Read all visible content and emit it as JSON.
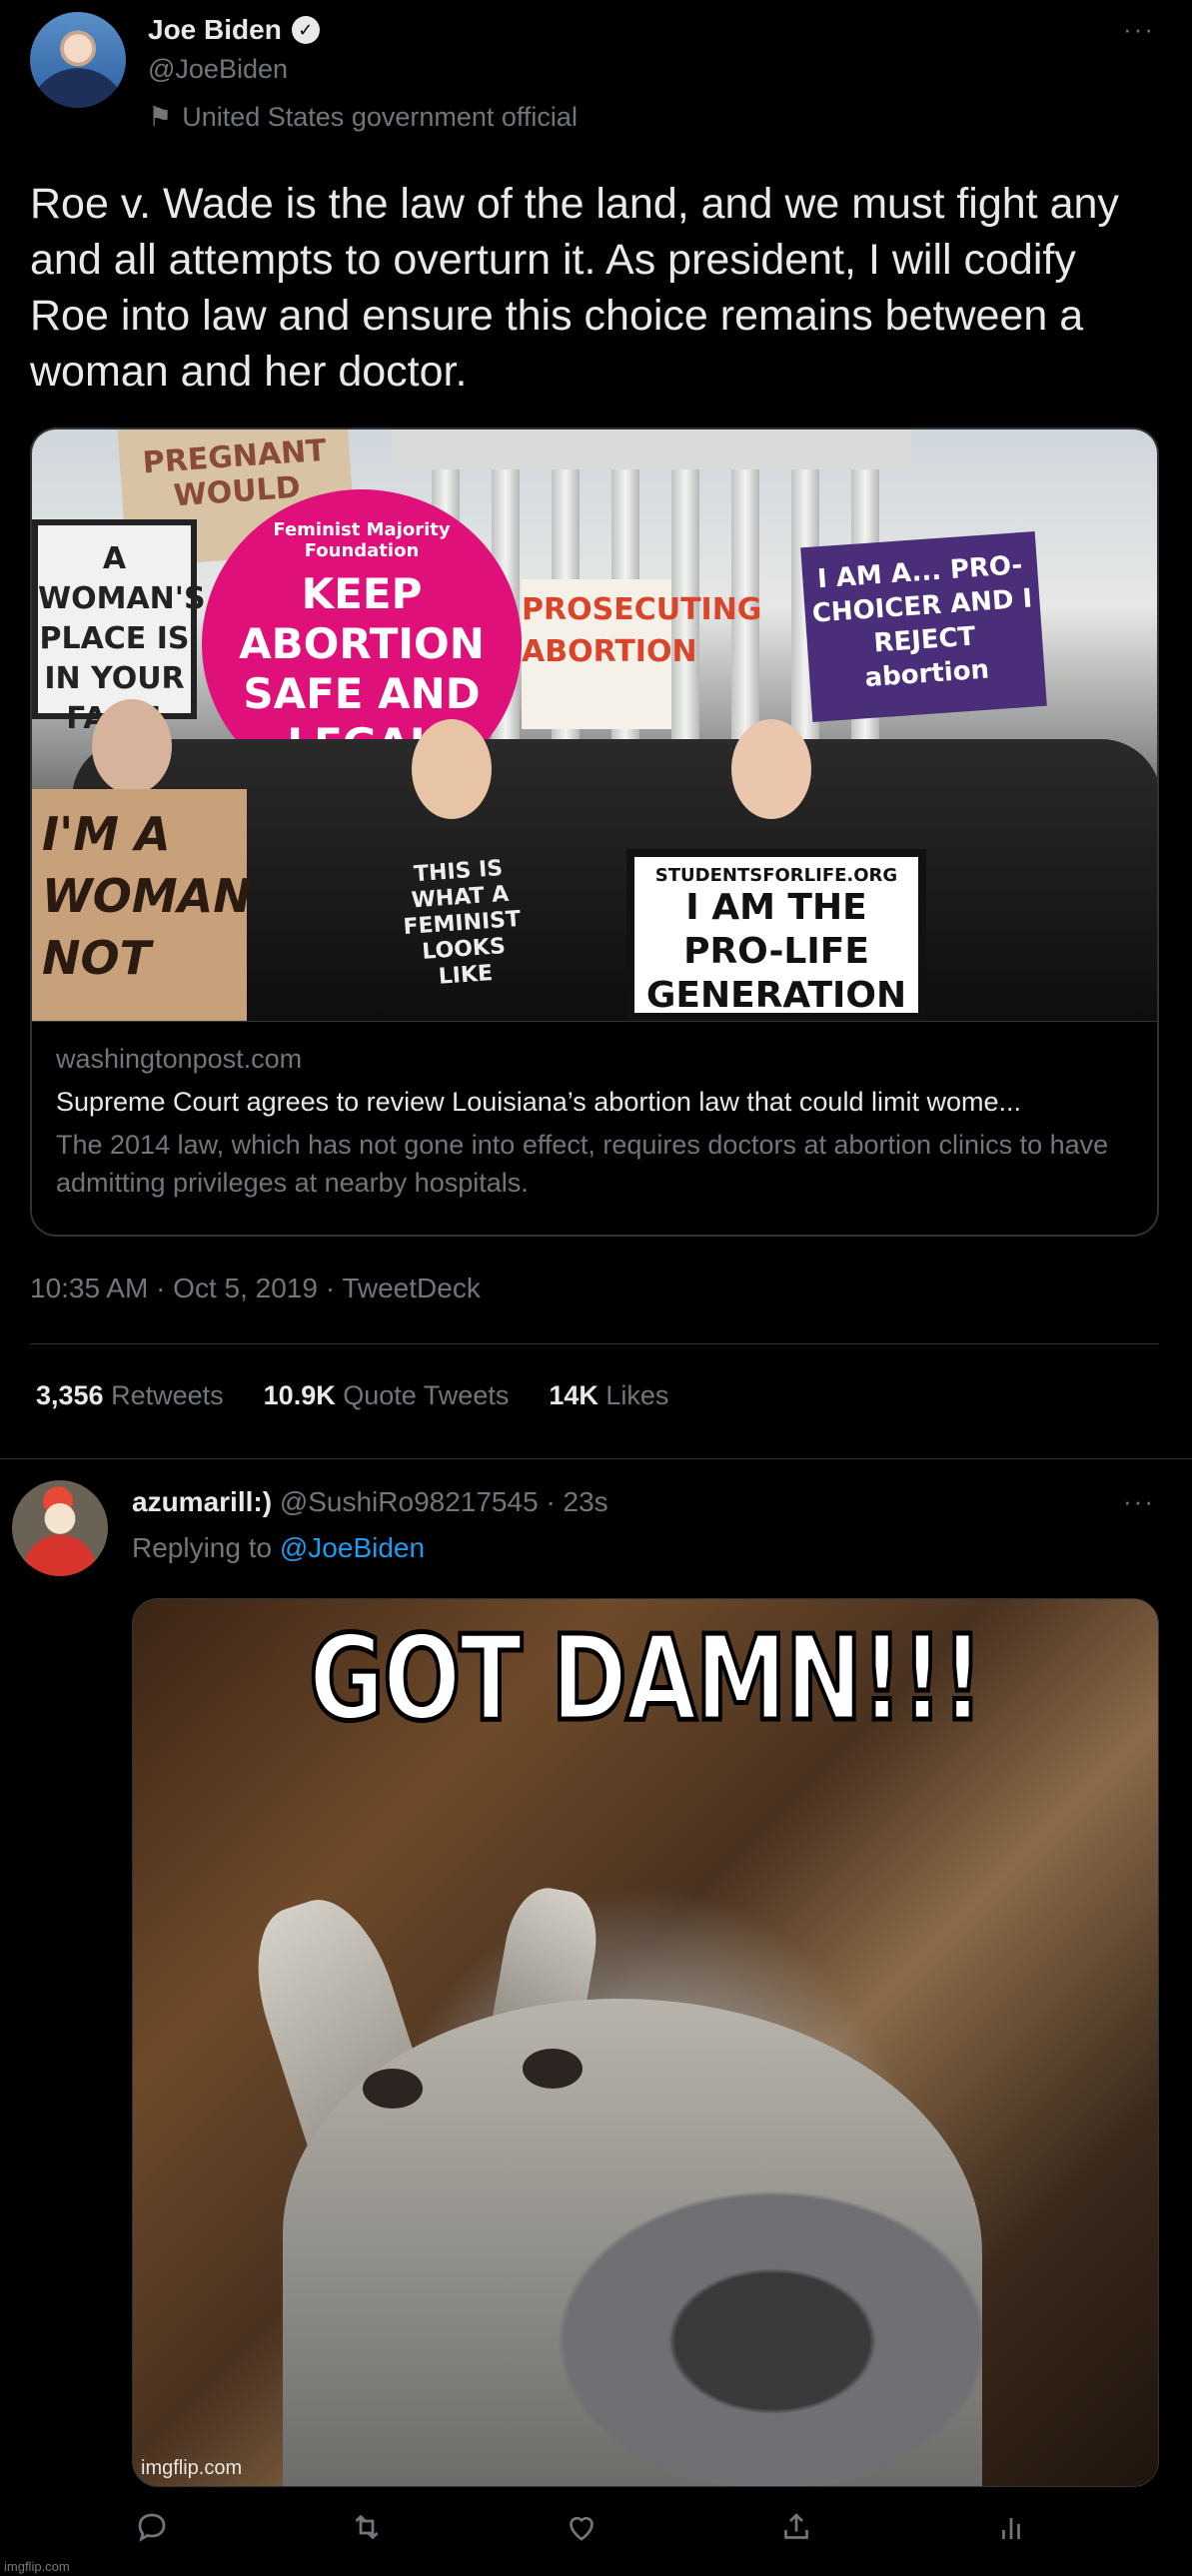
{
  "tweet": {
    "author_name": "Joe Biden",
    "author_handle": "@JoeBiden",
    "label": "United States government official",
    "more": "···",
    "text": "Roe v. Wade is the law of the land, and we must fight any and all attempts to overturn it. As president, I will codify Roe into law and ensure this choice remains between a woman and her doctor.",
    "card": {
      "image_signs": {
        "sign1": "KEEP ABORTION SAFE AND LEGAL",
        "sign1_org": "Feminist Majority Foundation",
        "sign2": "I AM THE PRO-LIFE GENERATION",
        "sign2_org": "STUDENTSFORLIFE.ORG",
        "sign3": "I AM A... PRO-CHOICER AND I REJECT abortion",
        "sign4": "I'M A WOMAN NOT",
        "sign5": "A WOMAN'S PLACE IS IN YOUR FACE!",
        "sign6": "PROSECUTING ABORTION",
        "sign7": "PREGNANT WOULD",
        "shirt": "THIS IS WHAT A FEMINIST LOOKS LIKE"
      },
      "domain": "washingtonpost.com",
      "title": "Supreme Court agrees to review Louisiana’s abortion law that could limit wome...",
      "description": "The 2014 law, which has not gone into effect, requires doctors at abortion clinics to have admitting privileges at nearby hospitals."
    },
    "timestamp": "10:35 AM · Oct 5, 2019 · TweetDeck",
    "stats": {
      "retweets_count": "3,356",
      "retweets_label": "Retweets",
      "quotes_count": "10.9K",
      "quotes_label": "Quote Tweets",
      "likes_count": "14K",
      "likes_label": "Likes"
    }
  },
  "reply": {
    "author_name": "azumarill:)",
    "author_handle": "@SushiRo98217545",
    "time": "· 23s",
    "more": "···",
    "replying_prefix": "Replying to",
    "replying_handle": "@JoeBiden",
    "meme_caption": "GOT DAMN!!!",
    "meme_watermark": "imgflip.com"
  },
  "page_watermark": "imgflip.com",
  "colors": {
    "background": "#000000",
    "text": "#e7e9ea",
    "muted": "#71767b",
    "link": "#1d9bf0",
    "border": "#2f3336",
    "sign_pink": "#e0107a"
  },
  "icons": [
    "verified-icon",
    "flag-icon",
    "reply-icon",
    "retweet-icon",
    "like-icon",
    "share-icon",
    "analytics-icon"
  ]
}
